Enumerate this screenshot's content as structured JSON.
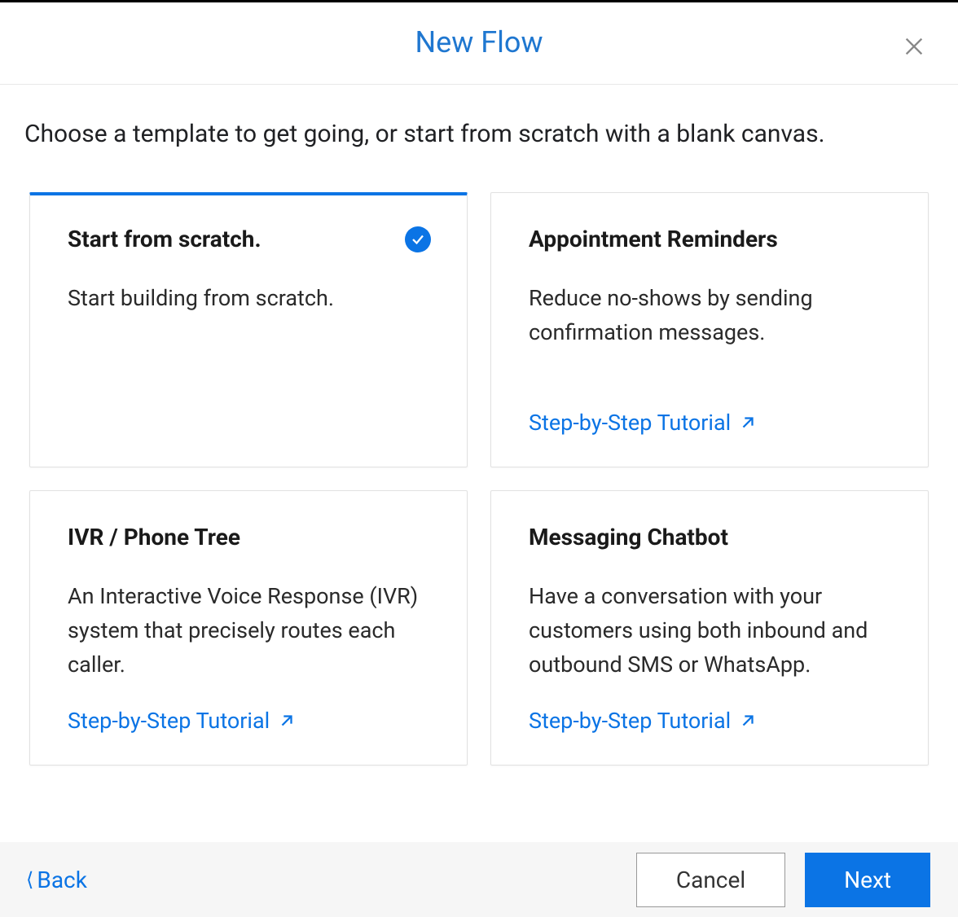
{
  "header": {
    "title": "New Flow"
  },
  "instruction": "Choose a template to get going, or start from scratch with a blank canvas.",
  "cards": [
    {
      "title": "Start from scratch.",
      "desc": "Start building from scratch.",
      "selected": true,
      "tutorial": null
    },
    {
      "title": "Appointment Reminders",
      "desc": "Reduce no-shows by sending confirmation messages.",
      "selected": false,
      "tutorial": "Step-by-Step Tutorial"
    },
    {
      "title": "IVR / Phone Tree",
      "desc": "An Interactive Voice Response (IVR) system that precisely routes each caller.",
      "selected": false,
      "tutorial": "Step-by-Step Tutorial"
    },
    {
      "title": "Messaging Chatbot",
      "desc": "Have a conversation with your customers using both inbound and outbound SMS or WhatsApp.",
      "selected": false,
      "tutorial": "Step-by-Step Tutorial"
    }
  ],
  "footer": {
    "back": "Back",
    "cancel": "Cancel",
    "next": "Next"
  }
}
